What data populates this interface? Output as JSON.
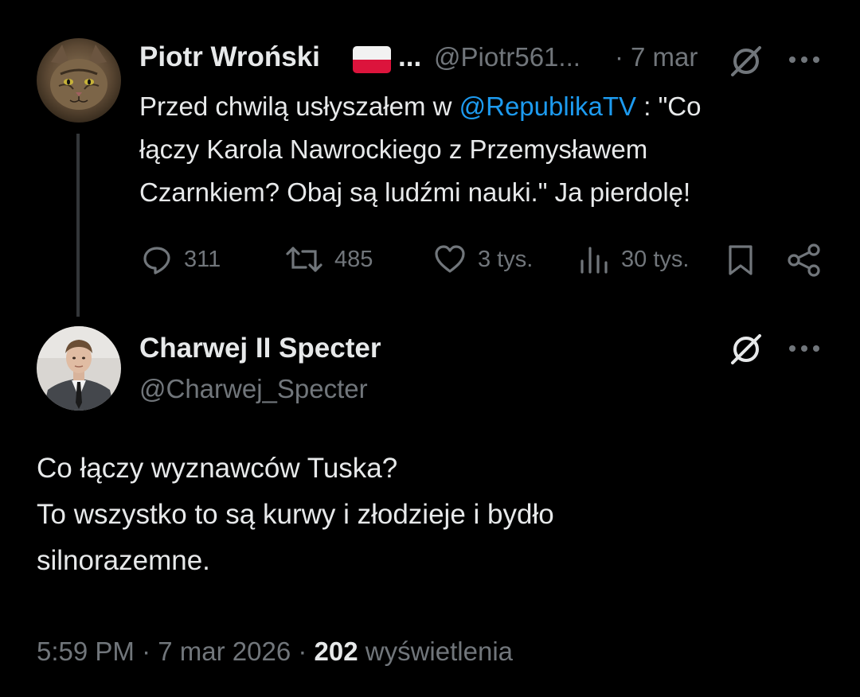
{
  "parent_tweet": {
    "author_name": "Piotr Wroński",
    "flag": "poland-flag",
    "ellipsis": "...",
    "handle": "@Piotr561...",
    "separator": "·",
    "date": "7 mar",
    "text_before": "Przed chwilą usłyszałem w ",
    "mention": "@RepublikaTV",
    "text_line1_after": " : \"Co",
    "text_line2": "łączy Karola Nawrockiego z Przemysławem",
    "text_line3": "Czarnkiem? Obaj są ludźmi nauki.\" Ja pierdolę!",
    "stats": {
      "replies": "311",
      "reposts": "485",
      "likes": "3 tys.",
      "views": "30 tys."
    }
  },
  "reply_tweet": {
    "author_name": "Charwej II Specter",
    "handle": "@Charwej_Specter",
    "text_line1": "Co łączy wyznawców Tuska?",
    "text_line2": "To wszystko to są kurwy i złodzieje i bydło",
    "text_line3": "silnorazemne.",
    "footer": {
      "time": "5:59 PM",
      "separator1": "·",
      "date": "7 mar 2026",
      "separator2": "·",
      "views_count": "202",
      "views_label": "wyświetlenia"
    }
  },
  "icons": [
    "grok-icon",
    "more-icon",
    "reply-icon",
    "repost-icon",
    "like-icon",
    "views-icon",
    "bookmark-icon",
    "share-icon"
  ],
  "colors": {
    "background": "#000000",
    "text": "#e7e9ea",
    "secondary": "#71767b",
    "link": "#1d9bf0"
  }
}
